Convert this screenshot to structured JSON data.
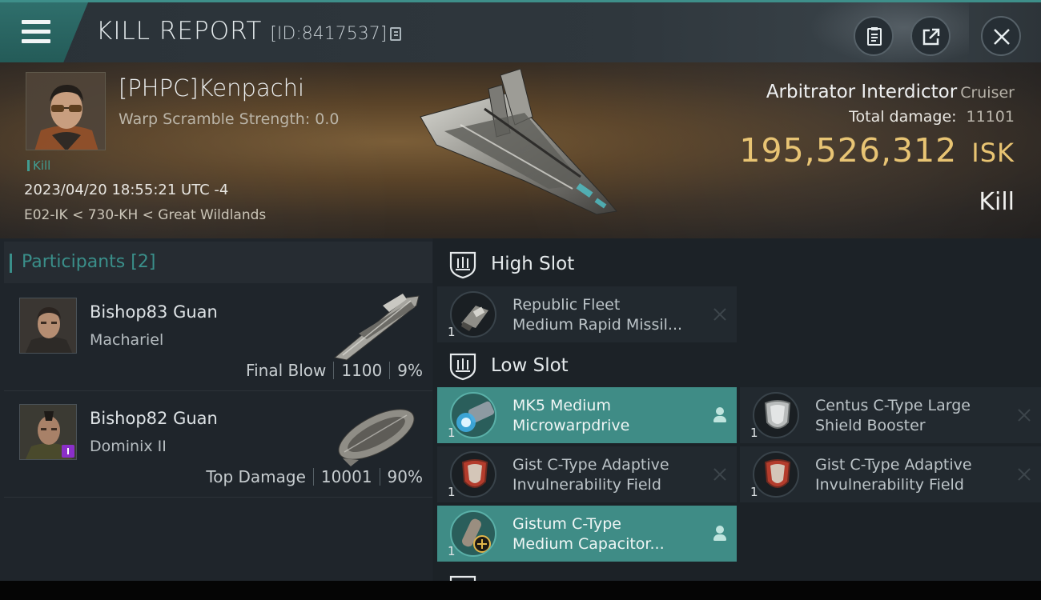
{
  "header": {
    "title": "KILL REPORT",
    "report_id": "[ID:8417537]"
  },
  "victim": {
    "name": "[PHPC]Kenpachi",
    "warp_scramble": "Warp Scramble Strength: 0.0",
    "tag": "Kill",
    "datetime": "2023/04/20 18:55:21 UTC -4",
    "location": "E02-IK < 730-KH < Great Wildlands",
    "ship": "Arbitrator Interdictor",
    "ship_class": "Cruiser",
    "total_damage_label": "Total damage:",
    "total_damage": "11101",
    "isk_value": "195,526,312",
    "isk_unit": "ISK",
    "result": "Kill"
  },
  "participants": {
    "label": "Participants",
    "count": "[2]",
    "items": [
      {
        "name": "Bishop83 Guan",
        "ship": "Machariel",
        "role": "Final Blow",
        "damage": "1100",
        "percent": "9%"
      },
      {
        "name": "Bishop82 Guan",
        "ship": "Dominix II",
        "role": "Top Damage",
        "damage": "10001",
        "percent": "90%"
      }
    ]
  },
  "slots": {
    "high": {
      "label": "High Slot",
      "modules": [
        {
          "line1": "Republic Fleet",
          "line2": "Medium Rapid Missil...",
          "qty": "1",
          "status": "destroyed"
        }
      ]
    },
    "low": {
      "label": "Low Slot",
      "modules": [
        {
          "line1": "MK5 Medium",
          "line2": "Microwarpdrive",
          "qty": "1",
          "status": "dropped"
        },
        {
          "line1": "Centus C-Type Large",
          "line2": "Shield Booster",
          "qty": "1",
          "status": "destroyed"
        },
        {
          "line1": "Gist C-Type Adaptive",
          "line2": "Invulnerability Field",
          "qty": "1",
          "status": "destroyed"
        },
        {
          "line1": "Gist C-Type Adaptive",
          "line2": "Invulnerability Field",
          "qty": "1",
          "status": "destroyed"
        },
        {
          "line1": "Gistum C-Type",
          "line2": "Medium Capacitor...",
          "qty": "1",
          "status": "dropped"
        }
      ]
    }
  },
  "colors": {
    "accent": "#3f8c86",
    "isk": "#e7c26e"
  }
}
